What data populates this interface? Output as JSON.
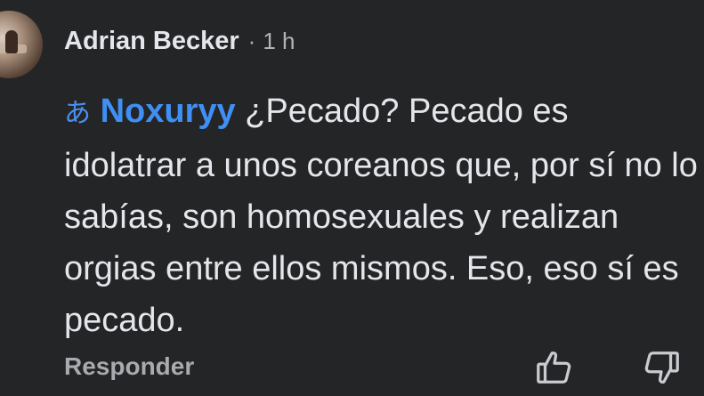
{
  "comment": {
    "author": "Adrian Becker",
    "separator": "·",
    "time": "1 h",
    "mention_icon": "あ",
    "mention_name": "Noxuryy",
    "text": " ¿Pecado? Pecado es idolatrar a unos coreanos que, por sí no lo sabías, son homosexuales y realizan orgias entre ellos mismos. Eso, eso sí es pecado."
  },
  "actions": {
    "reply_label": "Responder",
    "like_icon": "thumbs-up-icon",
    "dislike_icon": "thumbs-down-icon"
  },
  "colors": {
    "background": "#242526",
    "text": "#e4e6eb",
    "muted": "#b0b3b8",
    "mention": "#3f8ff5"
  }
}
